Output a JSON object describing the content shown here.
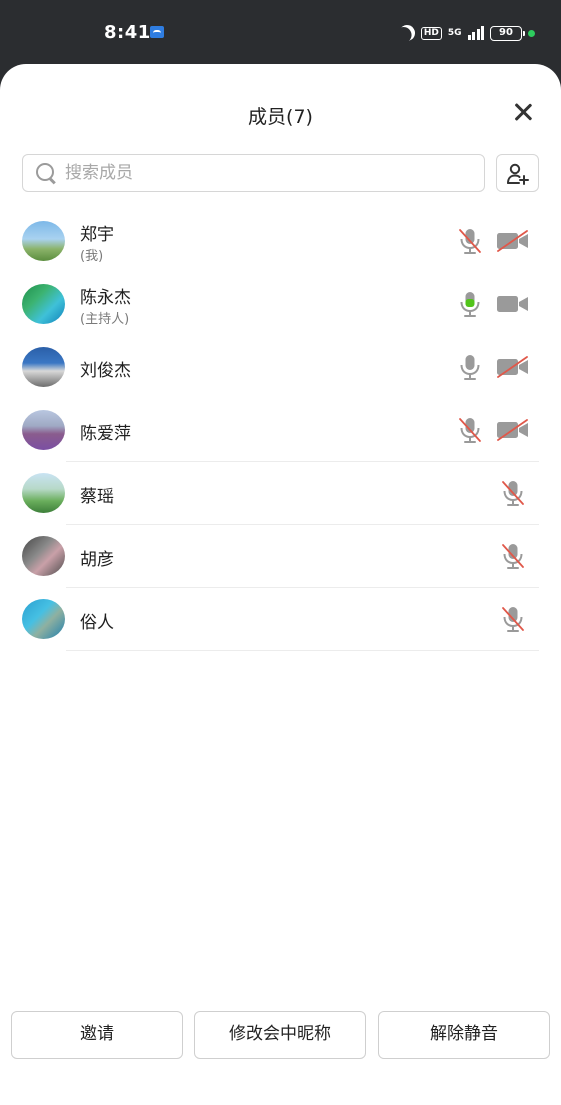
{
  "status_bar": {
    "time": "8:41",
    "hd_label": "HD",
    "network_label": "5G",
    "battery_level": "90",
    "accent_dot_color": "#2ecc5e"
  },
  "header": {
    "title": "成员(7)",
    "close_icon": "close-icon"
  },
  "search": {
    "placeholder": "搜索成员",
    "value": ""
  },
  "add_member_icon": "add-person-icon",
  "members": [
    {
      "name": "郑宇",
      "role": "(我)",
      "mic": "muted",
      "camera": "off",
      "avatar_theme": "landscape-sky"
    },
    {
      "name": "陈永杰",
      "role": "(主持人)",
      "mic": "active",
      "camera": "on",
      "avatar_theme": "palm-beach"
    },
    {
      "name": "刘俊杰",
      "role": "",
      "mic": "unmuted",
      "camera": "off",
      "avatar_theme": "coast"
    },
    {
      "name": "陈爱萍",
      "role": "",
      "mic": "muted",
      "camera": "off",
      "avatar_theme": "lavender-field"
    },
    {
      "name": "蔡瑶",
      "role": "",
      "mic": "muted",
      "camera": "none",
      "avatar_theme": "green-hills"
    },
    {
      "name": "胡彦",
      "role": "",
      "mic": "muted",
      "camera": "none",
      "avatar_theme": "street"
    },
    {
      "name": "俗人",
      "role": "",
      "mic": "muted",
      "camera": "none",
      "avatar_theme": "sea-rock"
    }
  ],
  "colors": {
    "icon_gray": "#9a9a9a",
    "mute_red": "#e0584a",
    "mic_active_green": "#52c41a"
  },
  "footer": {
    "invite_label": "邀请",
    "rename_label": "修改会中昵称",
    "unmute_label": "解除静音"
  }
}
